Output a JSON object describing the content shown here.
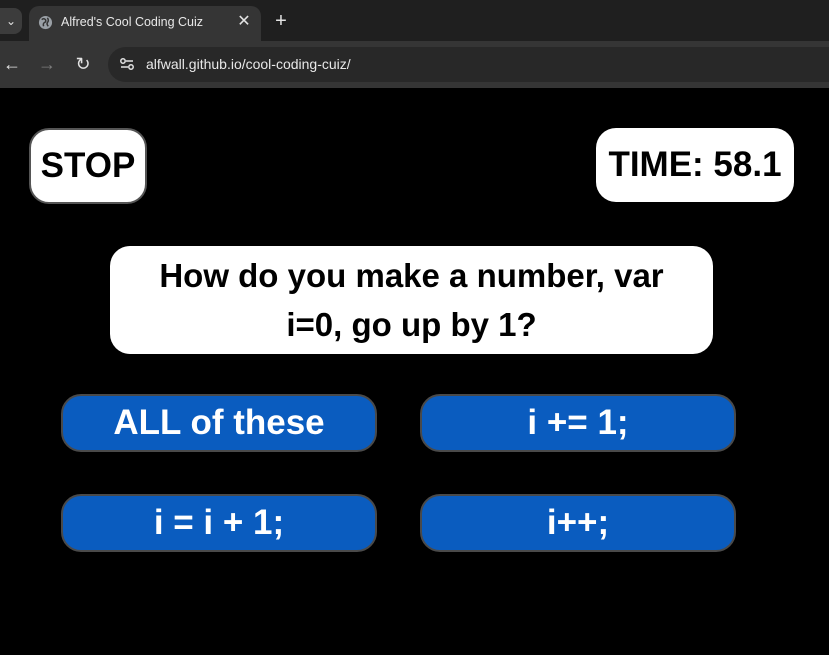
{
  "browser": {
    "tab": {
      "title": "Alfred's Cool Coding Cuiz",
      "favicon": "globe-icon",
      "close_glyph": "✕"
    },
    "new_tab_glyph": "+",
    "tab_search_glyph": "⌄",
    "nav": {
      "back_glyph": "←",
      "forward_glyph": "→",
      "reload_glyph": "↻"
    },
    "url": "alfwall.github.io/cool-coding-cuiz/"
  },
  "quiz": {
    "stop_label": "STOP",
    "timer_text": "TIME: 58.1",
    "question": "How do you make a number, var i=0, go up by 1?",
    "answers": [
      "ALL of these",
      "i += 1;",
      "i = i + 1;",
      "i++;"
    ]
  },
  "colors": {
    "answer_bg": "#0a5cbf",
    "page_bg": "#000000",
    "panel_bg": "#ffffff"
  }
}
